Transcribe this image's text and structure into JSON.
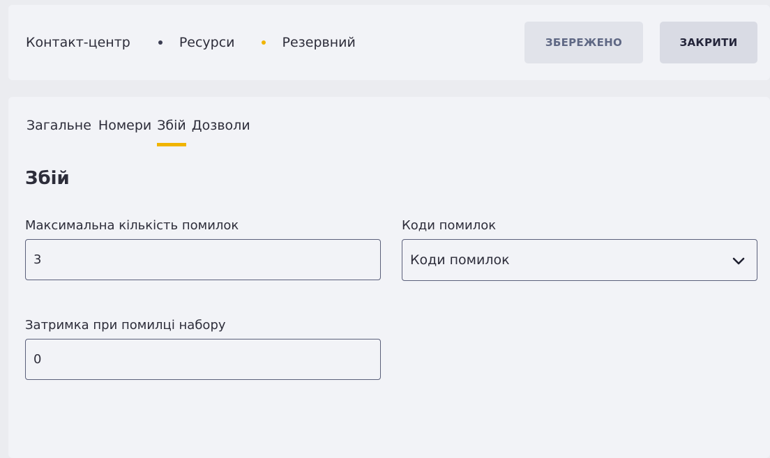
{
  "header": {
    "breadcrumb": [
      "Контакт-центр",
      "Ресурси",
      "Резервний"
    ],
    "saved_label": "ЗБЕРЕЖЕНО",
    "close_label": "ЗАКРИТИ"
  },
  "tabs": [
    {
      "label": "Загальне",
      "active": false
    },
    {
      "label": "Номери",
      "active": false
    },
    {
      "label": "Збій",
      "active": true
    },
    {
      "label": "Дозволи",
      "active": false
    }
  ],
  "section_title": "Збій",
  "form": {
    "max_errors": {
      "label": "Максимальна кількість помилок",
      "value": "3"
    },
    "error_codes": {
      "label": "Коди помилок",
      "value": "Коди помилок"
    },
    "dial_error_delay": {
      "label": "Затримка при помилці набору",
      "value": "0"
    }
  },
  "icons": {
    "dropdown": "chevron-down-icon",
    "dot_dark": "bullet-icon",
    "dot_active": "bullet-icon"
  },
  "colors": {
    "accent": "#f0b400",
    "bg": "#f2f3f7",
    "text": "#2d2d3a"
  }
}
